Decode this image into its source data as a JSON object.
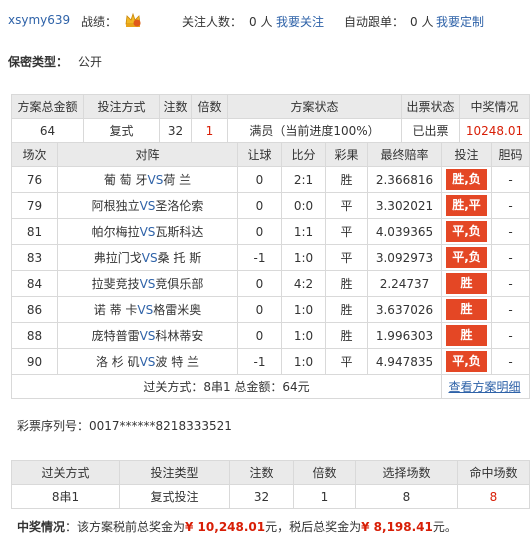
{
  "topbar": {
    "username": "xsymy639",
    "record_label": "战绩：",
    "followers_label": "关注人数：",
    "followers_value": "0 人",
    "follow_link": "我要关注",
    "auto_follow_label": "自动跟单：",
    "auto_follow_value": "0 人",
    "custom_link": "我要定制"
  },
  "secrecy": {
    "label": "保密类型：",
    "value": "公开"
  },
  "plan_header": [
    "方案总金额",
    "投注方式",
    "注数",
    "倍数",
    "方案状态",
    "出票状态",
    "中奖情况"
  ],
  "plan_row": {
    "total": "64",
    "method": "复式",
    "bets": "32",
    "multiple": "1",
    "status": "满员（当前进度100%）",
    "ticket": "已出票",
    "prize": "10248.01"
  },
  "match_header": [
    "场次",
    "对阵",
    "让球",
    "比分",
    "彩果",
    "最终赔率",
    "投注",
    "胆码"
  ],
  "matches": [
    {
      "no": "76",
      "home": "葡 萄 牙",
      "away": "荷 兰",
      "hc": "0",
      "score": "2:1",
      "result": "胜",
      "odds": "2.366816",
      "bet": "胜,负",
      "banker": "-"
    },
    {
      "no": "79",
      "home": "阿根独立",
      "away": "圣洛伦索",
      "hc": "0",
      "score": "0:0",
      "result": "平",
      "odds": "3.302021",
      "bet": "胜,平",
      "banker": "-"
    },
    {
      "no": "81",
      "home": "帕尔梅拉",
      "away": "瓦斯科达",
      "hc": "0",
      "score": "1:1",
      "result": "平",
      "odds": "4.039365",
      "bet": "平,负",
      "banker": "-"
    },
    {
      "no": "83",
      "home": "弗拉门戈",
      "away": "桑 托 斯",
      "hc": "-1",
      "score": "1:0",
      "result": "平",
      "odds": "3.092973",
      "bet": "平,负",
      "banker": "-"
    },
    {
      "no": "84",
      "home": "拉斐竞技",
      "away": "竞俱乐部",
      "hc": "0",
      "score": "4:2",
      "result": "胜",
      "odds": "2.24737",
      "bet": "胜",
      "banker": "-"
    },
    {
      "no": "86",
      "home": "诺 蒂 卡",
      "away": "格雷米奥",
      "hc": "0",
      "score": "1:0",
      "result": "胜",
      "odds": "3.637026",
      "bet": "胜",
      "banker": "-"
    },
    {
      "no": "88",
      "home": "庞特普雷",
      "away": "科林蒂安",
      "hc": "0",
      "score": "1:0",
      "result": "胜",
      "odds": "1.996303",
      "bet": "胜",
      "banker": "-"
    },
    {
      "no": "90",
      "home": "洛 杉 矶",
      "away": "波 特 兰",
      "hc": "-1",
      "score": "1:0",
      "result": "平",
      "odds": "4.947835",
      "bet": "平,负",
      "banker": "-"
    }
  ],
  "vs": "VS",
  "footer": {
    "pass_text": "过关方式：8串1 总金额：64元",
    "detail_link": "查看方案明细"
  },
  "serial": "彩票序列号：0017******8218333521",
  "sub_header": [
    "过关方式",
    "投注类型",
    "注数",
    "倍数",
    "选择场数",
    "命中场数"
  ],
  "sub_row": {
    "pass": "8串1",
    "type": "复式投注",
    "bets": "32",
    "multiple": "1",
    "selected": "8",
    "hits": "8"
  },
  "prize_line": {
    "label": "中奖情况",
    "text1": "：该方案税前总奖金为",
    "pre_tax": "¥ 10,248.01",
    "text2": "元，税后总奖金为",
    "post_tax": "¥ 8,198.41",
    "text3": "元。"
  },
  "colors": {
    "accent_red": "#d81e06",
    "bet_bg": "#e44725",
    "link_blue": "#2e62a8",
    "header_bg": "#eaeaea"
  }
}
